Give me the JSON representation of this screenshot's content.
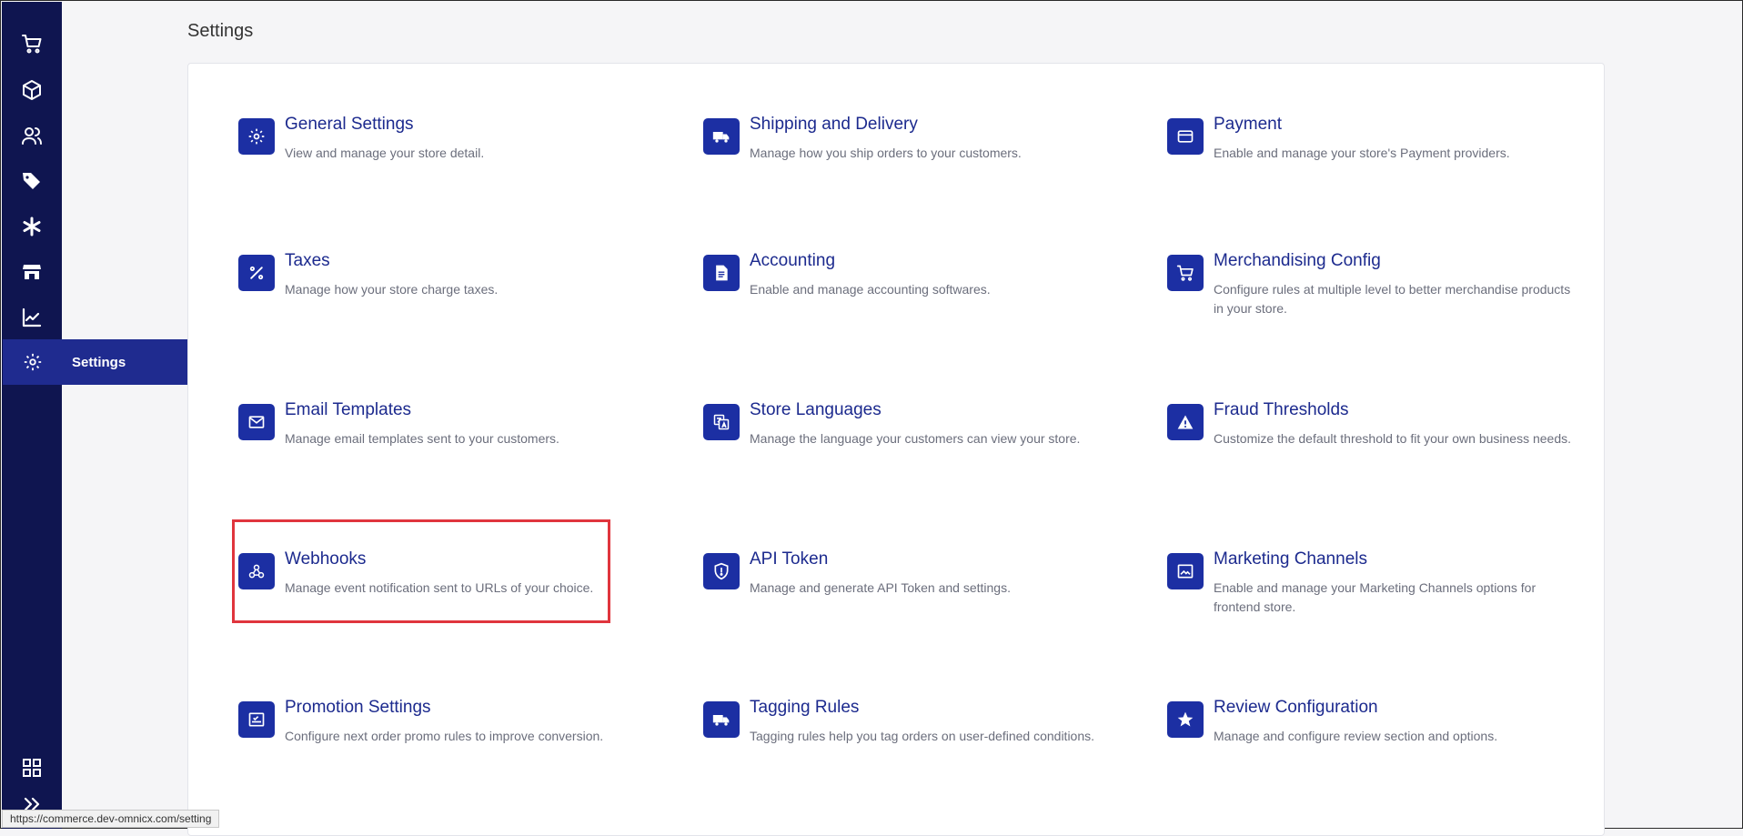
{
  "page": {
    "title": "Settings"
  },
  "sidebar": {
    "items": [
      {
        "icon": "cart-icon"
      },
      {
        "icon": "box-icon"
      },
      {
        "icon": "users-icon"
      },
      {
        "icon": "tags-icon"
      },
      {
        "icon": "asterisk-icon"
      },
      {
        "icon": "store-icon"
      },
      {
        "icon": "chart-icon"
      }
    ],
    "active": {
      "icon": "gear-icon",
      "label": "Settings"
    },
    "bottom": [
      {
        "icon": "apps-grid-icon"
      },
      {
        "icon": "expand-chevrons-icon"
      }
    ]
  },
  "settings": [
    {
      "title": "General Settings",
      "desc": "View and manage your store detail.",
      "icon": "gear-icon"
    },
    {
      "title": "Shipping and Delivery",
      "desc": "Manage how you ship orders to your customers.",
      "icon": "truck-icon"
    },
    {
      "title": "Payment",
      "desc": "Enable and manage your store's Payment providers.",
      "icon": "credit-card-icon"
    },
    {
      "title": "Taxes",
      "desc": "Manage how your store charge taxes.",
      "icon": "percent-icon"
    },
    {
      "title": "Accounting",
      "desc": "Enable and manage accounting softwares.",
      "icon": "document-icon"
    },
    {
      "title": "Merchandising Config",
      "desc": "Configure rules at multiple level to better merchandise products in your store.",
      "icon": "cart-icon"
    },
    {
      "title": "Email Templates",
      "desc": "Manage email templates sent to your customers.",
      "icon": "envelope-icon"
    },
    {
      "title": "Store Languages",
      "desc": "Manage the language your customers can view your store.",
      "icon": "translate-icon"
    },
    {
      "title": "Fraud Thresholds",
      "desc": "Customize the default threshold to fit your own business needs.",
      "icon": "warning-icon"
    },
    {
      "title": "Webhooks",
      "desc": "Manage event notification sent to URLs of your choice.",
      "icon": "webhook-icon"
    },
    {
      "title": "API Token",
      "desc": "Manage and generate API Token and settings.",
      "icon": "shield-icon"
    },
    {
      "title": "Marketing Channels",
      "desc": "Enable and manage your Marketing Channels options for frontend store.",
      "icon": "image-icon"
    },
    {
      "title": "Promotion Settings",
      "desc": "Configure next order promo rules to improve conversion.",
      "icon": "promo-icon"
    },
    {
      "title": "Tagging Rules",
      "desc": "Tagging rules help you tag orders on user-defined conditions.",
      "icon": "truck-icon"
    },
    {
      "title": "Review Configuration",
      "desc": "Manage and configure review section and options.",
      "icon": "star-icon"
    }
  ],
  "status_bar": {
    "url": "https://commerce.dev-omnicx.com/setting"
  },
  "colors": {
    "sidebar_bg": "#0f1550",
    "active_bg": "#1f2b8f",
    "accent": "#1c2fa3",
    "highlight": "#e0353d"
  }
}
